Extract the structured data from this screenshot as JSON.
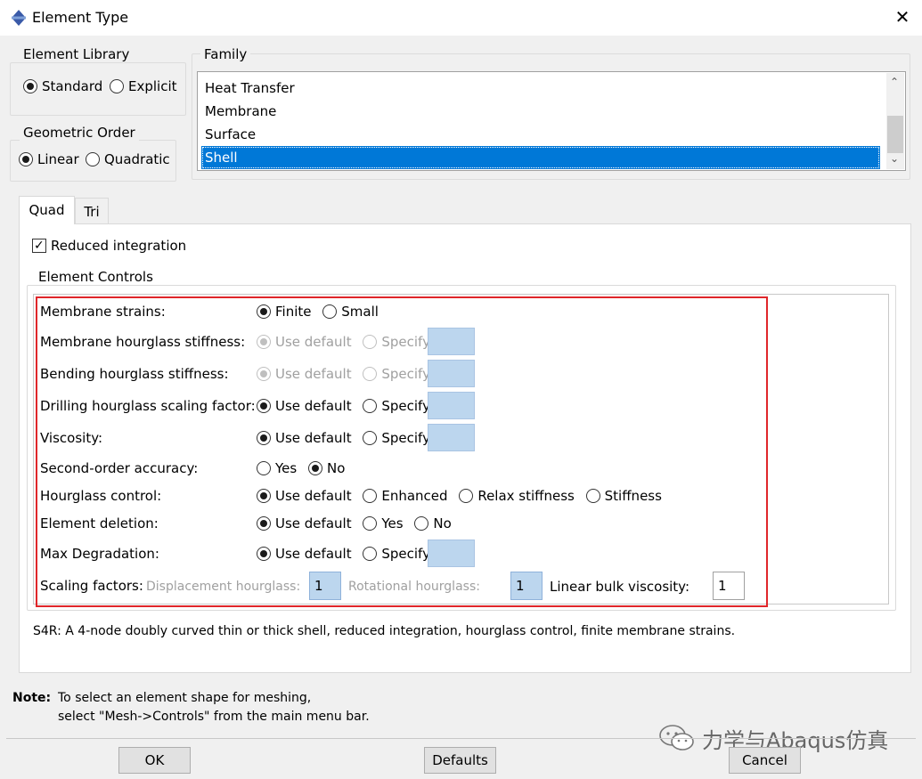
{
  "window": {
    "title": "Element Type",
    "close_glyph": "✕"
  },
  "element_library": {
    "legend": "Element Library",
    "options": [
      {
        "label": "Standard",
        "selected": true
      },
      {
        "label": "Explicit",
        "selected": false
      }
    ]
  },
  "geometric_order": {
    "legend": "Geometric Order",
    "options": [
      {
        "label": "Linear",
        "selected": true
      },
      {
        "label": "Quadratic",
        "selected": false
      }
    ]
  },
  "family": {
    "legend": "Family",
    "items": [
      "Heat Transfer",
      "Membrane",
      "Surface",
      "Shell"
    ],
    "selected": "Shell"
  },
  "tabs": [
    {
      "label": "Quad",
      "active": true
    },
    {
      "label": "Tri",
      "active": false
    }
  ],
  "reduced_integration": {
    "label": "Reduced integration",
    "checked": true
  },
  "element_controls": {
    "legend": "Element Controls",
    "rows": [
      {
        "label": "Membrane strains:",
        "options": [
          "Finite",
          "Small"
        ],
        "selected": "Finite"
      },
      {
        "label": "Membrane hourglass stiffness:",
        "options": [
          "Use default",
          "Specify"
        ],
        "selected": "Use default",
        "disabled": true
      },
      {
        "label": "Bending hourglass stiffness:",
        "options": [
          "Use default",
          "Specify"
        ],
        "selected": "Use default",
        "disabled": true
      },
      {
        "label": "Drilling hourglass scaling factor:",
        "options": [
          "Use default",
          "Specify"
        ],
        "selected": "Use default"
      },
      {
        "label": "Viscosity:",
        "options": [
          "Use default",
          "Specify"
        ],
        "selected": "Use default"
      },
      {
        "label": "Second-order accuracy:",
        "options": [
          "Yes",
          "No"
        ],
        "selected": "No"
      },
      {
        "label": "Hourglass control:",
        "options": [
          "Use default",
          "Enhanced",
          "Relax stiffness",
          "Stiffness"
        ],
        "selected": "Use default"
      },
      {
        "label": "Element deletion:",
        "options": [
          "Use default",
          "Yes",
          "No"
        ],
        "selected": "Use default"
      },
      {
        "label": "Max Degradation:",
        "options": [
          "Use default",
          "Specify"
        ],
        "selected": "Use default"
      }
    ],
    "scaling": {
      "label": "Scaling factors:",
      "displacement_label": "Displacement hourglass:",
      "displacement_value": "1",
      "rotational_label": "Rotational hourglass:",
      "rotational_value": "1",
      "bulk_label": "Linear bulk viscosity:",
      "bulk_value": "1"
    }
  },
  "description": "S4R:  A 4-node doubly curved thin or thick shell, reduced integration, hourglass control, finite membrane strains.",
  "note": {
    "label": "Note:",
    "line1": "To select an element shape for meshing,",
    "line2": "select \"Mesh->Controls\" from the main menu bar."
  },
  "watermark": "力学与Abaqus仿真",
  "buttons": {
    "ok": "OK",
    "defaults": "Defaults",
    "cancel": "Cancel"
  },
  "colors": {
    "selection": "#0078d7",
    "highlight_frame": "#e0262a",
    "spec_box": "#bcd6ee"
  }
}
